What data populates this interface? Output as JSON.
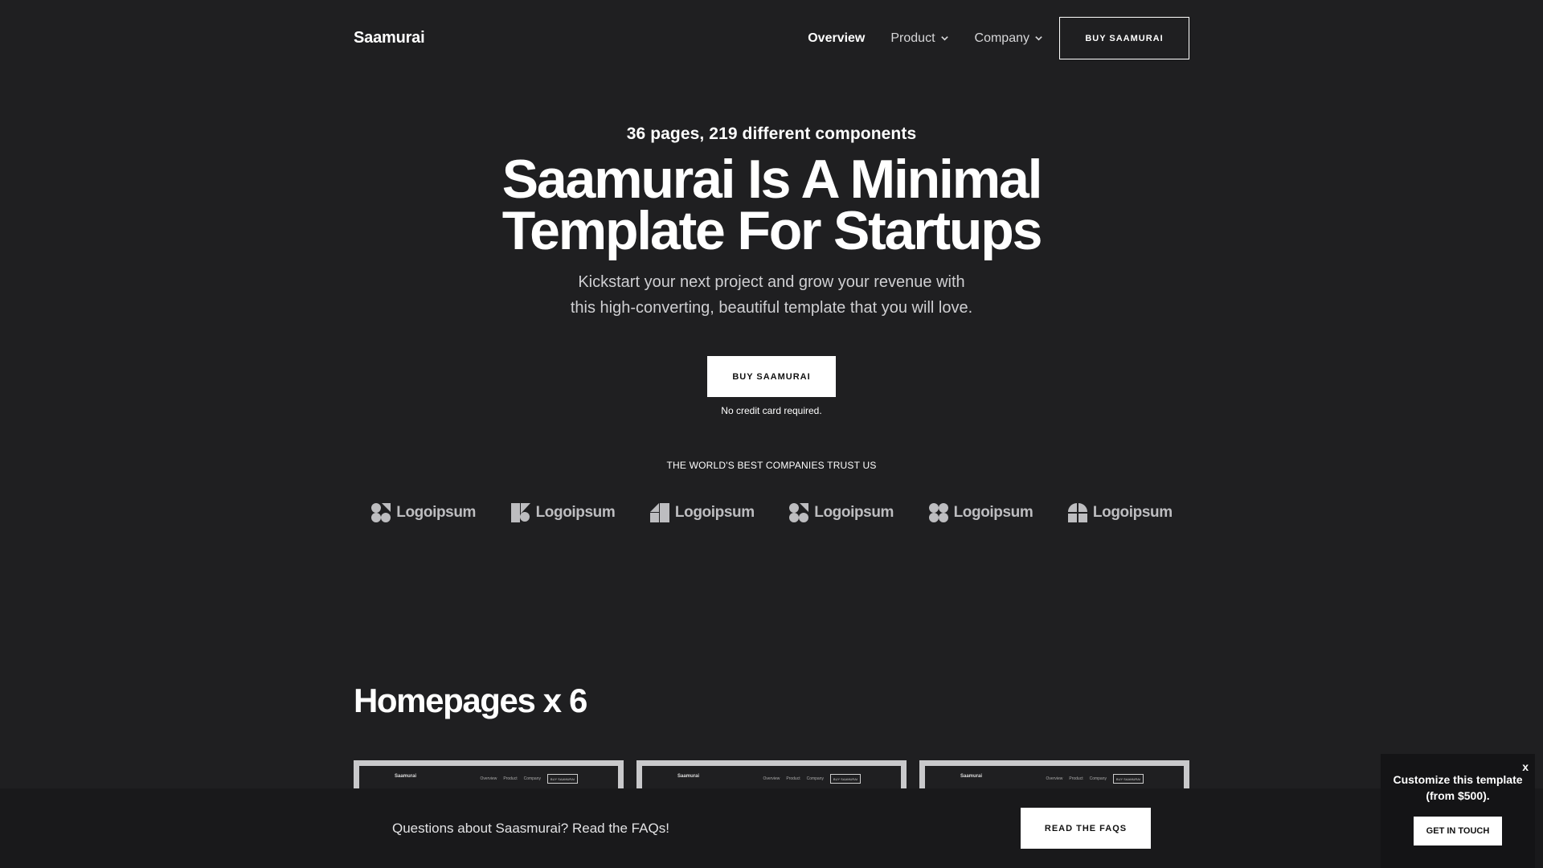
{
  "header": {
    "brand": "Saamurai",
    "nav": [
      {
        "label": "Overview",
        "has_dropdown": false
      },
      {
        "label": "Product",
        "has_dropdown": true
      },
      {
        "label": "Company",
        "has_dropdown": true
      }
    ],
    "cta_label": "BUY SAAMURAI"
  },
  "hero": {
    "eyebrow": "36 pages, 219 different components",
    "title_line1": "Saamurai Is A Minimal",
    "title_line2": "Template For Startups",
    "subtitle_line1": "Kickstart your next project and grow your revenue with",
    "subtitle_line2": "this high-converting, beautiful template that you will love.",
    "cta_label": "BUY SAAMURAI",
    "note": "No credit card required."
  },
  "trust": {
    "label": "THE WORLD'S BEST COMPANIES TRUST US",
    "logos": [
      {
        "name": "Logoipsum",
        "icon": "logo-mark-1"
      },
      {
        "name": "Logoipsum",
        "icon": "logo-mark-2"
      },
      {
        "name": "Logoipsum",
        "icon": "logo-mark-3"
      },
      {
        "name": "Logoipsum",
        "icon": "logo-mark-4"
      },
      {
        "name": "Logoipsum",
        "icon": "logo-mark-5"
      },
      {
        "name": "Logoipsum",
        "icon": "logo-mark-6"
      }
    ]
  },
  "section": {
    "title": "Homepages x 6",
    "thumb_brand": "Saamurai",
    "thumb_nav": [
      "Overview",
      "Product",
      "Company"
    ],
    "thumb_button": "BUY SAAMURAI"
  },
  "faq_bar": {
    "text": "Questions about Saasmurai? Read the FAQs!",
    "button_label": "READ THE FAQS"
  },
  "popup": {
    "close_label": "x",
    "text": "Customize this template (from $500).",
    "button_label": "GET IN TOUCH"
  },
  "colors": {
    "background": "#1f1f21",
    "bar": "#19191b",
    "text": "#ffffff"
  }
}
